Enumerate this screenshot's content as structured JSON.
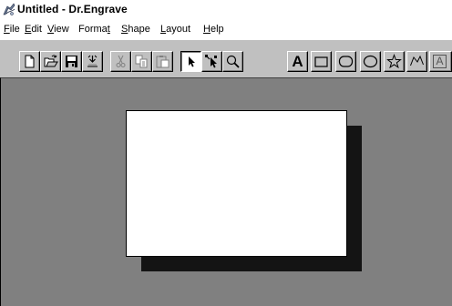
{
  "window": {
    "title": "Untitled - Dr.Engrave",
    "app_icon": "dr-engrave-app-icon"
  },
  "menu": [
    {
      "key": "file",
      "accel": "F",
      "rest": "ile"
    },
    {
      "key": "edit",
      "accel": "E",
      "rest": "dit"
    },
    {
      "key": "view",
      "accel": "V",
      "rest": "iew"
    },
    {
      "key": "format",
      "pre": "Forma",
      "accel": "t",
      "rest": ""
    },
    {
      "key": "shape",
      "accel": "S",
      "rest": "hape"
    },
    {
      "key": "layout",
      "accel": "L",
      "rest": "ayout"
    },
    {
      "key": "help",
      "accel": "H",
      "rest": "elp"
    }
  ],
  "toolbar": {
    "buttons": [
      {
        "name": "new-file-icon",
        "state": "normal"
      },
      {
        "name": "open-folder-icon",
        "state": "normal"
      },
      {
        "name": "save-disk-icon",
        "state": "normal"
      },
      {
        "name": "engrave-output-icon",
        "state": "normal"
      },
      {
        "name": "cut-scissors-icon",
        "state": "disabled"
      },
      {
        "name": "copy-icon",
        "state": "disabled"
      },
      {
        "name": "paste-clipboard-icon",
        "state": "disabled"
      },
      {
        "name": "select-arrow-icon",
        "state": "pressed"
      },
      {
        "name": "node-edit-arrow-icon",
        "state": "normal"
      },
      {
        "name": "zoom-magnifier-icon",
        "state": "normal"
      },
      {
        "name": "text-tool",
        "state": "normal",
        "label": "A"
      },
      {
        "name": "rectangle-icon",
        "state": "normal"
      },
      {
        "name": "rounded-rectangle-icon",
        "state": "normal"
      },
      {
        "name": "ellipse-icon",
        "state": "normal"
      },
      {
        "name": "star-icon",
        "state": "normal"
      },
      {
        "name": "polyline-icon",
        "state": "normal"
      },
      {
        "name": "text-frame-tool",
        "state": "normal",
        "label": "A"
      }
    ]
  },
  "colors": {
    "chrome": "#c0c0c0",
    "workspace": "#808080",
    "page": "#ffffff",
    "page_shadow": "#141414",
    "disabled_icon": "#808080"
  }
}
